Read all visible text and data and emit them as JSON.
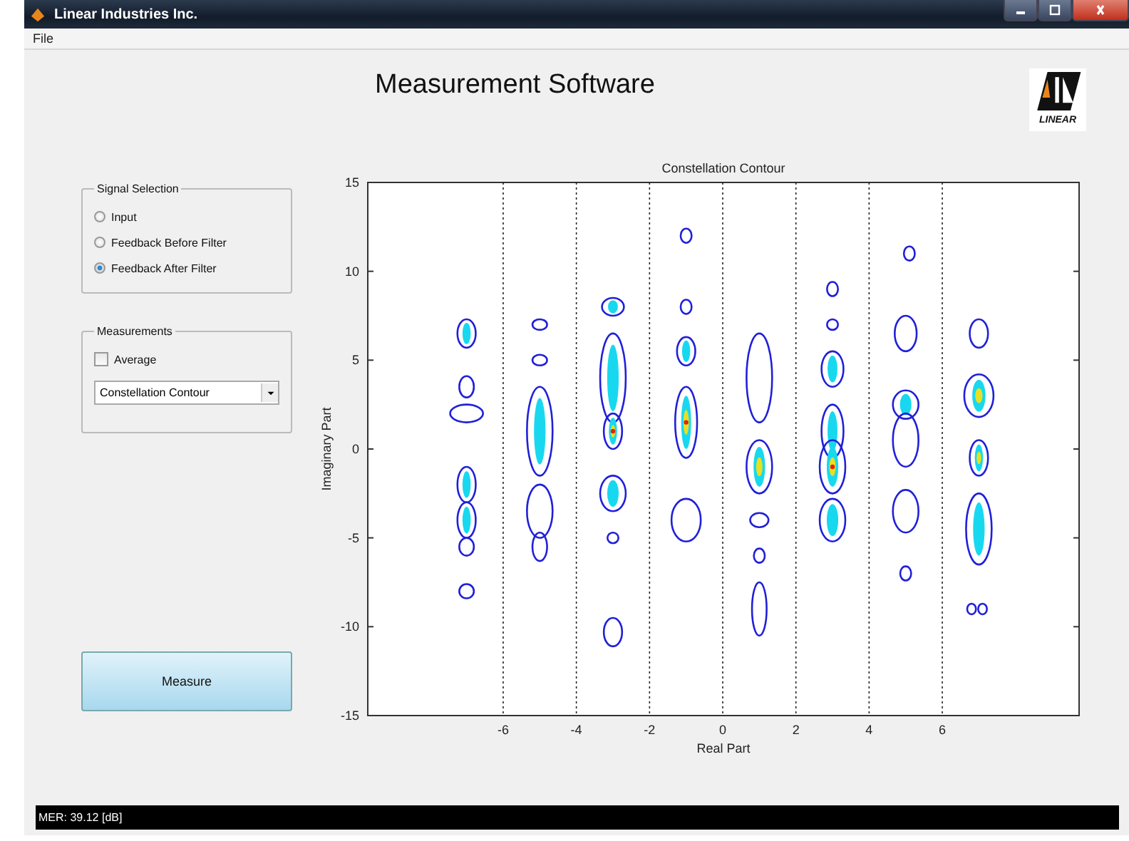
{
  "window": {
    "title": "Linear Industries Inc."
  },
  "menu": [
    "File"
  ],
  "header": {
    "title": "Measurement Software",
    "logo_text": "LINEAR"
  },
  "signal_selection": {
    "label": "Signal Selection",
    "options": [
      {
        "label": "Input",
        "selected": false
      },
      {
        "label": "Feedback Before Filter",
        "selected": false
      },
      {
        "label": "Feedback After Filter",
        "selected": true
      }
    ]
  },
  "measurements": {
    "label": "Measurements",
    "average": {
      "label": "Average",
      "checked": false
    },
    "dropdown": {
      "value": "Constellation Contour"
    }
  },
  "measure_button": "Measure",
  "plot": {
    "title": "Constellation Contour",
    "xlabel": "Real Part",
    "ylabel": "Imaginary Part",
    "xticks": [
      "-6",
      "-4",
      "-2",
      "0",
      "2",
      "4",
      "6"
    ],
    "yticks": [
      "15",
      "10",
      "5",
      "0",
      "-5",
      "-10",
      "-15"
    ]
  },
  "status_bar": "MER: 39.12 [dB]"
}
